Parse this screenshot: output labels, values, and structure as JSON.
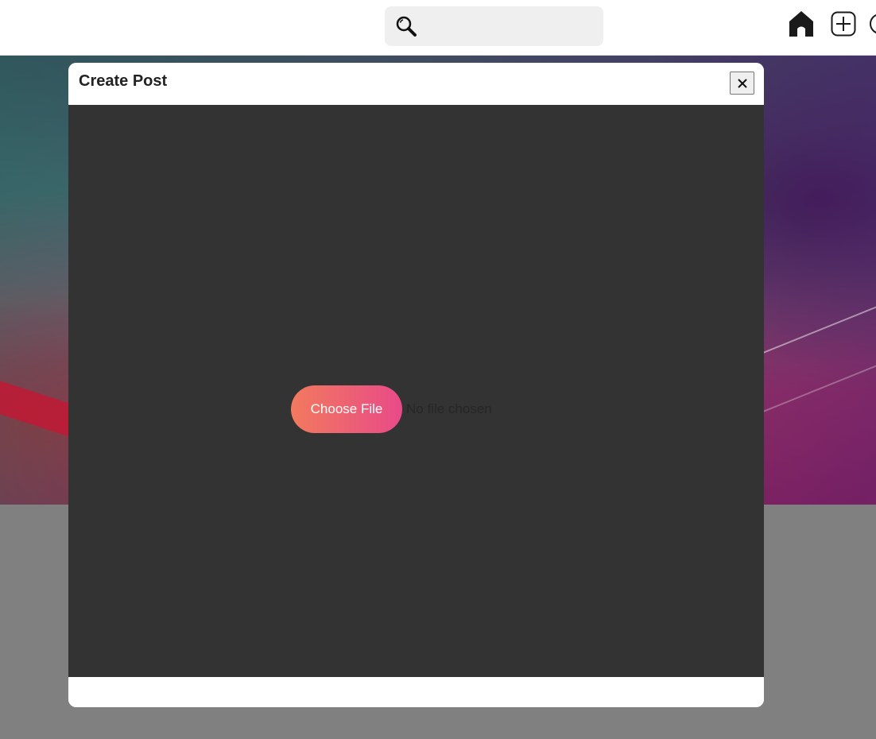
{
  "topbar": {
    "search": {
      "placeholder": "",
      "value": "",
      "icon": "search-icon"
    },
    "nav_icons": [
      "home-icon",
      "create-icon",
      "profile-icon"
    ]
  },
  "modal": {
    "title": "Create Post",
    "close_label": "✕",
    "file_input": {
      "button_label": "Choose File",
      "status_text": "No file chosen"
    },
    "colors": {
      "body_bg": "#333333",
      "button_gradient_start": "#f27a5e",
      "button_gradient_end": "#e84a88"
    }
  }
}
